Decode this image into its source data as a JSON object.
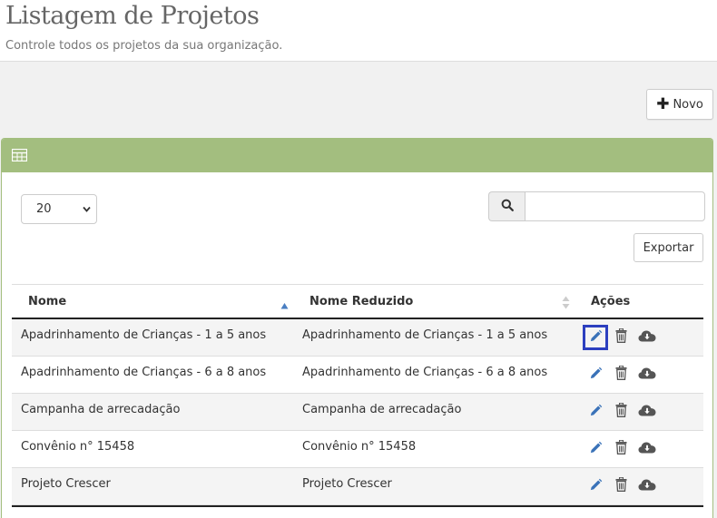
{
  "header": {
    "title": "Listagem de Projetos",
    "subtitle": "Controle todos os projetos da sua organização."
  },
  "toolbar": {
    "new_label": "Novo"
  },
  "controls": {
    "page_size": "20",
    "search_value": "",
    "export_label": "Exportar"
  },
  "table": {
    "columns": [
      "Nome",
      "Nome Reduzido",
      "Ações"
    ],
    "rows": [
      {
        "nome": "Apadrinhamento de Crianças - 1 a 5 anos",
        "reduzido": "Apadrinhamento de Crianças - 1 a 5 anos"
      },
      {
        "nome": "Apadrinhamento de Crianças - 6 a 8 anos",
        "reduzido": "Apadrinhamento de Crianças - 6 a 8 anos"
      },
      {
        "nome": "Campanha de arrecadação",
        "reduzido": "Campanha de arrecadação"
      },
      {
        "nome": "Convênio n° 15458",
        "reduzido": "Convênio n° 15458"
      },
      {
        "nome": "Projeto Crescer",
        "reduzido": "Projeto Crescer"
      }
    ],
    "row_actions": [
      "pencil-icon",
      "trash-icon",
      "cloud-download-icon"
    ]
  },
  "colors": {
    "panel_accent": "#a3be7f",
    "edit_icon": "#3a72b8",
    "action_icons": "#555555",
    "focus_outline": "#2c3fbf"
  }
}
